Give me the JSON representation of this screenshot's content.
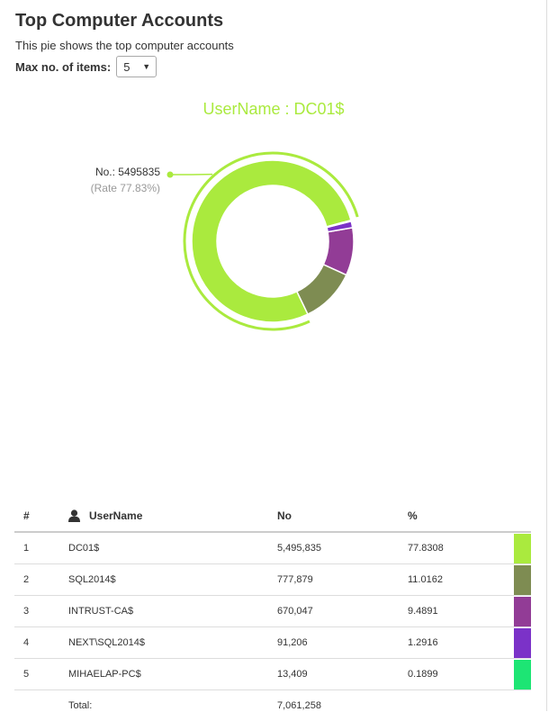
{
  "header": {
    "title": "Top Computer Accounts",
    "subtitle": "This pie shows the top computer accounts",
    "max_label": "Max no. of items:",
    "max_value": "5"
  },
  "chart_data": {
    "type": "pie",
    "title": "UserName : DC01$",
    "highlight": {
      "label": "No.: 5495835",
      "rate": "(Rate 77.83%)"
    },
    "categories": [
      "DC01$",
      "SQL2014$",
      "INTRUST-CA$",
      "NEXT\\SQL2014$",
      "MIHAELAP-PC$"
    ],
    "values": [
      5495835,
      777879,
      670047,
      91206,
      13409
    ],
    "colors": [
      "#aaea3e",
      "#7e8c52",
      "#923c96",
      "#7b32c8",
      "#1de574"
    ]
  },
  "table": {
    "headers": {
      "num": "#",
      "user": "UserName",
      "no": "No",
      "pct": "%"
    },
    "rows": [
      {
        "num": "1",
        "user": "DC01$",
        "no": "5,495,835",
        "pct": "77.8308",
        "color": "#aaea3e"
      },
      {
        "num": "2",
        "user": "SQL2014$",
        "no": "777,879",
        "pct": "11.0162",
        "color": "#7e8c52"
      },
      {
        "num": "3",
        "user": "INTRUST-CA$",
        "no": "670,047",
        "pct": "9.4891",
        "color": "#923c96"
      },
      {
        "num": "4",
        "user": "NEXT\\SQL2014$",
        "no": "91,206",
        "pct": "1.2916",
        "color": "#7b32c8"
      },
      {
        "num": "5",
        "user": "MIHAELAP-PC$",
        "no": "13,409",
        "pct": "0.1899",
        "color": "#1de574"
      }
    ],
    "total_label": "Total:",
    "total_value": "7,061,258"
  }
}
